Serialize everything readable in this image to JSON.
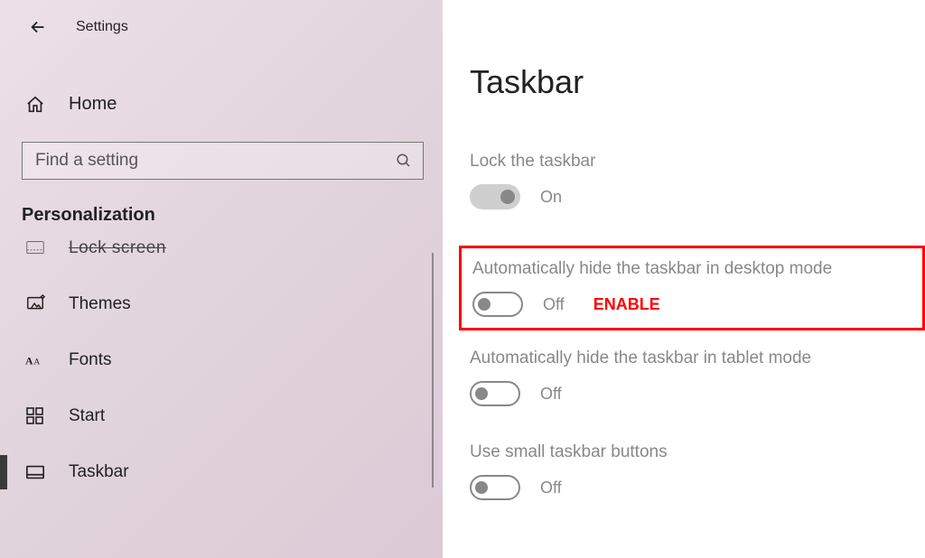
{
  "header": {
    "title": "Settings"
  },
  "sidebar": {
    "home": "Home",
    "search_placeholder": "Find a setting",
    "section": "Personalization",
    "items": [
      {
        "label": "Lock screen",
        "icon": "lock-screen-icon",
        "cut": true
      },
      {
        "label": "Themes",
        "icon": "themes-icon"
      },
      {
        "label": "Fonts",
        "icon": "fonts-icon"
      },
      {
        "label": "Start",
        "icon": "start-icon"
      },
      {
        "label": "Taskbar",
        "icon": "taskbar-icon",
        "selected": true
      }
    ]
  },
  "page": {
    "title": "Taskbar",
    "settings": [
      {
        "label": "Lock the taskbar",
        "state": "On",
        "on": true
      },
      {
        "label": "Automatically hide the taskbar in desktop mode",
        "state": "Off",
        "on": false,
        "annotation": "ENABLE"
      },
      {
        "label": "Automatically hide the taskbar in tablet mode",
        "state": "Off",
        "on": false
      },
      {
        "label": "Use small taskbar buttons",
        "state": "Off",
        "on": false
      }
    ]
  },
  "colors": {
    "accent_red": "#ff0000"
  }
}
